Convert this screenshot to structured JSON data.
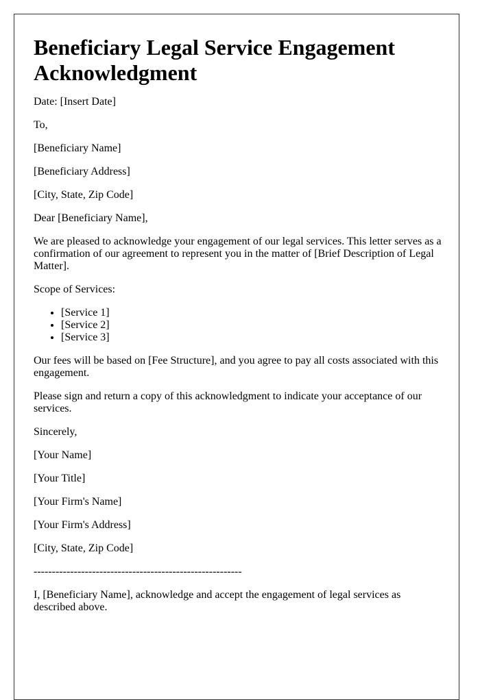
{
  "document": {
    "title": "Beneficiary Legal Service Engagement Acknowledgment",
    "date_line": "Date: [Insert Date]",
    "to_line": "To,",
    "recipient": {
      "name": "[Beneficiary Name]",
      "address": "[Beneficiary Address]",
      "city_state_zip": "[City, State, Zip Code]"
    },
    "salutation": "Dear [Beneficiary Name],",
    "intro_paragraph": "We are pleased to acknowledge your engagement of our legal services. This letter serves as a confirmation of our agreement to represent you in the matter of [Brief Description of Legal Matter].",
    "scope_heading": "Scope of Services:",
    "services": [
      "[Service 1]",
      "[Service 2]",
      "[Service 3]"
    ],
    "fees_paragraph": "Our fees will be based on [Fee Structure], and you agree to pay all costs associated with this engagement.",
    "sign_request_paragraph": "Please sign and return a copy of this acknowledgment to indicate your acceptance of our services.",
    "closing": "Sincerely,",
    "sender": {
      "name": "[Your Name]",
      "title": "[Your Title]",
      "firm_name": "[Your Firm's Name]",
      "firm_address": "[Your Firm's Address]",
      "city_state_zip": "[City, State, Zip Code]"
    },
    "separator": "---------------------------------------------------------",
    "acceptance_paragraph": "I, [Beneficiary Name], acknowledge and accept the engagement of legal services as described above."
  }
}
